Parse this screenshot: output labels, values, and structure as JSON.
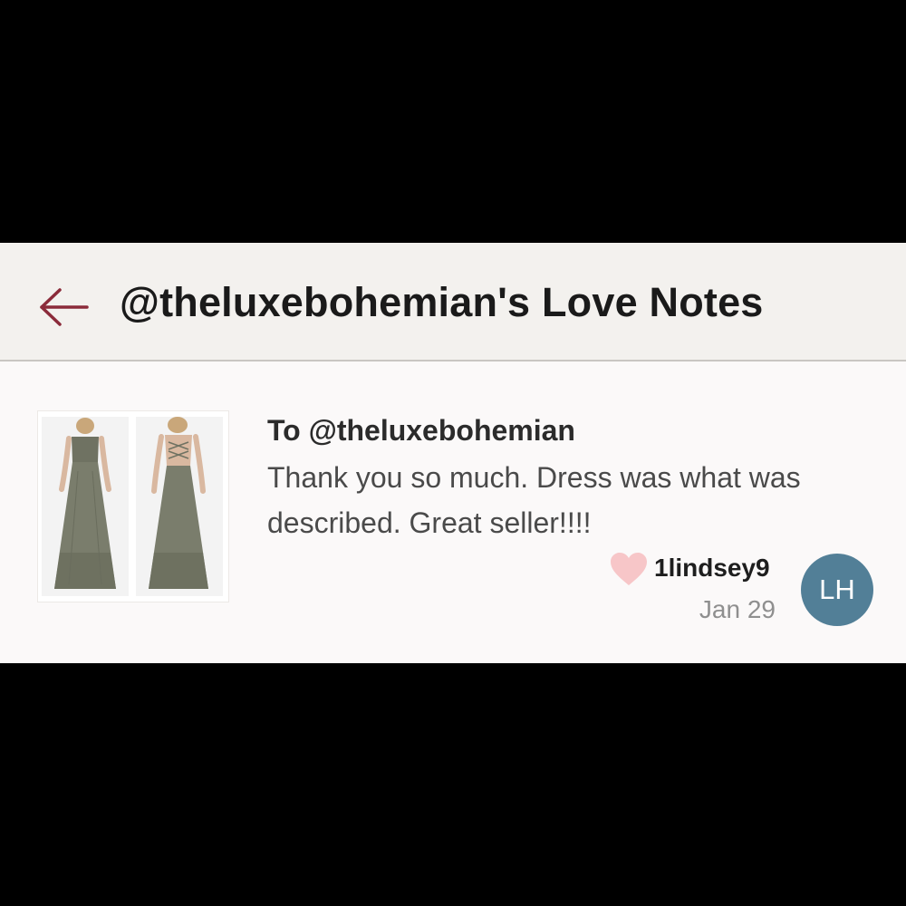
{
  "header": {
    "back_icon": "arrow-left-icon",
    "title": "@theluxebohemian's Love Notes"
  },
  "note": {
    "recipient": "To @theluxebohemian",
    "message": "Thank you so much. Dress was what was described. Great seller!!!!",
    "heart_icon": "heart-icon",
    "author_username": "1lindsey9",
    "date": "Jan 29",
    "avatar_initials": "LH",
    "listing_image": "olive-maxi-dress-front-and-back"
  },
  "colors": {
    "accent": "#8b2b3a",
    "header_bg": "#f3f1ee",
    "card_bg": "#fbf9f9",
    "heart": "#f7c6c8",
    "avatar": "#527f97"
  }
}
